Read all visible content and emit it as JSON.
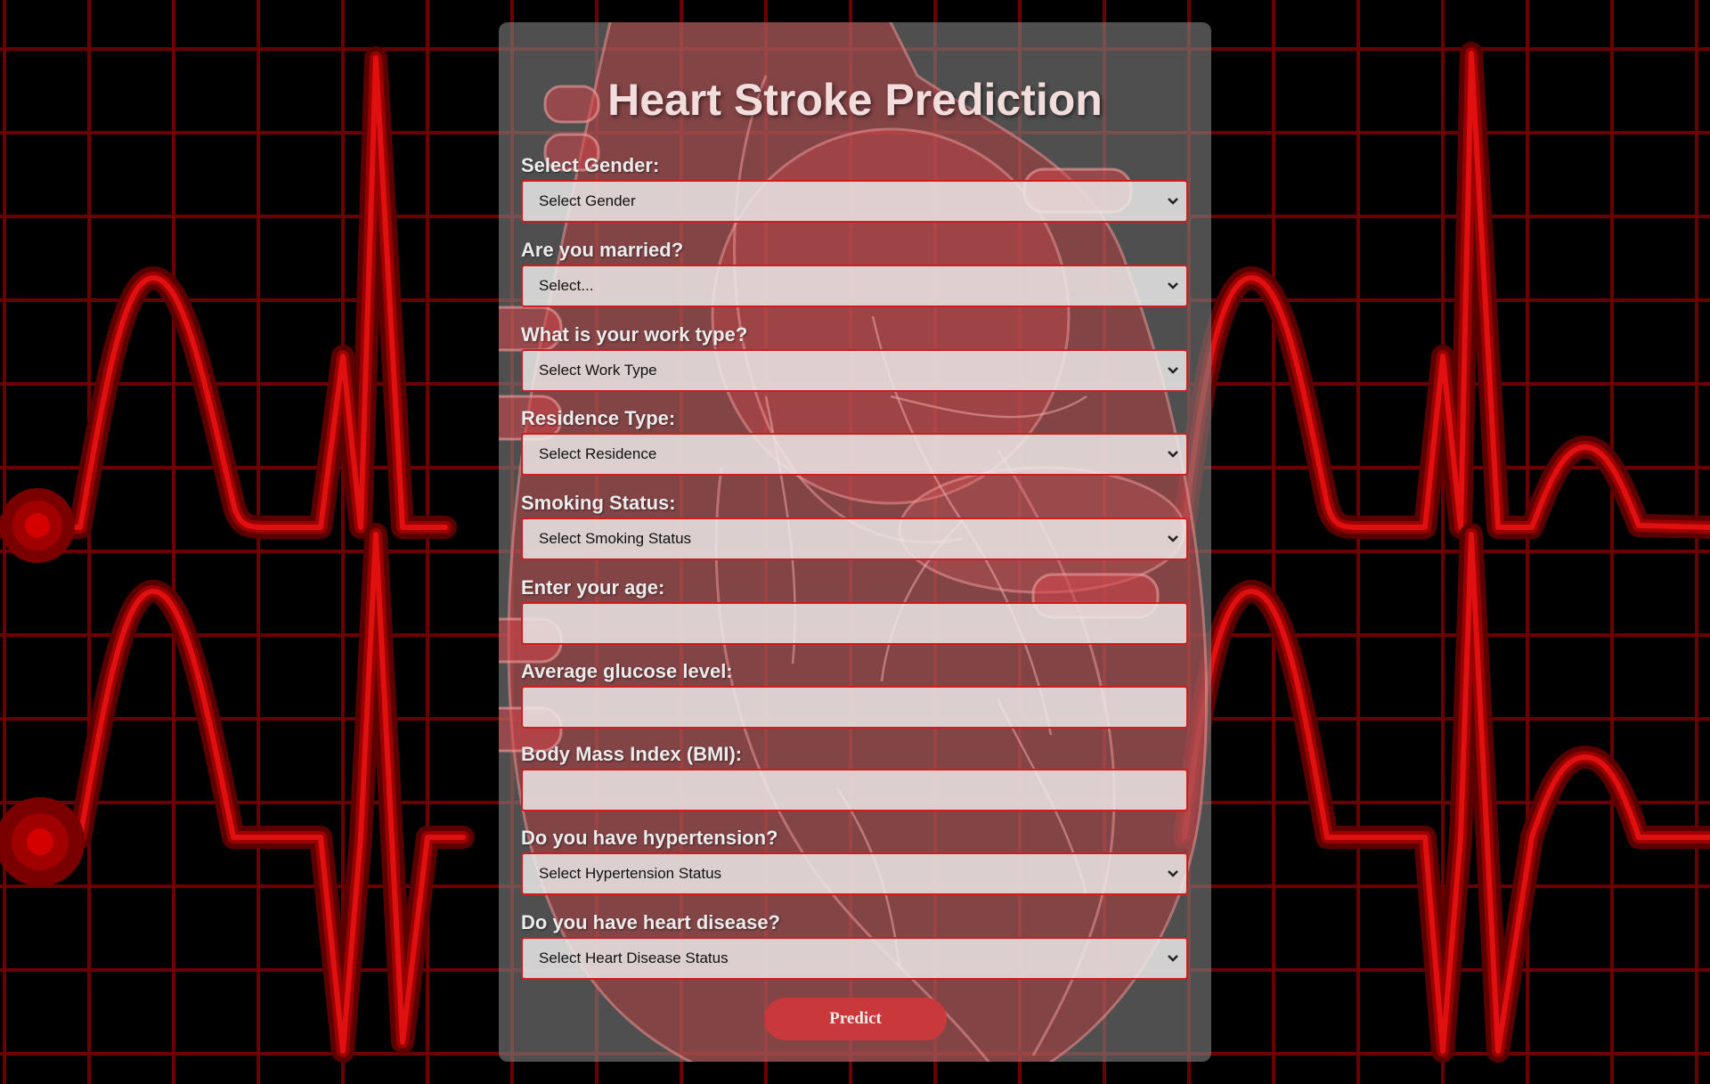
{
  "page": {
    "title": "Heart Stroke Prediction"
  },
  "form": {
    "fields": [
      {
        "label": "Select Gender:",
        "type": "select",
        "placeholder": "Select Gender"
      },
      {
        "label": "Are you married?",
        "type": "select",
        "placeholder": "Select..."
      },
      {
        "label": "What is your work type?",
        "type": "select",
        "placeholder": "Select Work Type"
      },
      {
        "label": "Residence Type:",
        "type": "select",
        "placeholder": "Select Residence"
      },
      {
        "label": "Smoking Status:",
        "type": "select",
        "placeholder": "Select Smoking Status"
      },
      {
        "label": "Enter your age:",
        "type": "input",
        "value": ""
      },
      {
        "label": "Average glucose level:",
        "type": "input",
        "value": ""
      },
      {
        "label": "Body Mass Index (BMI):",
        "type": "input",
        "value": ""
      },
      {
        "label": "Do you have hypertension?",
        "type": "select",
        "placeholder": "Select Hypertension Status"
      },
      {
        "label": "Do you have heart disease?",
        "type": "select",
        "placeholder": "Select Heart Disease Status"
      }
    ],
    "submit_label": "Predict"
  },
  "icons": {
    "select_arrow": "chevron-down-icon"
  },
  "colors": {
    "accent": "#d11c1c",
    "button": "#c9393b",
    "background": "#000000",
    "ecg_line": "#cc0000"
  }
}
